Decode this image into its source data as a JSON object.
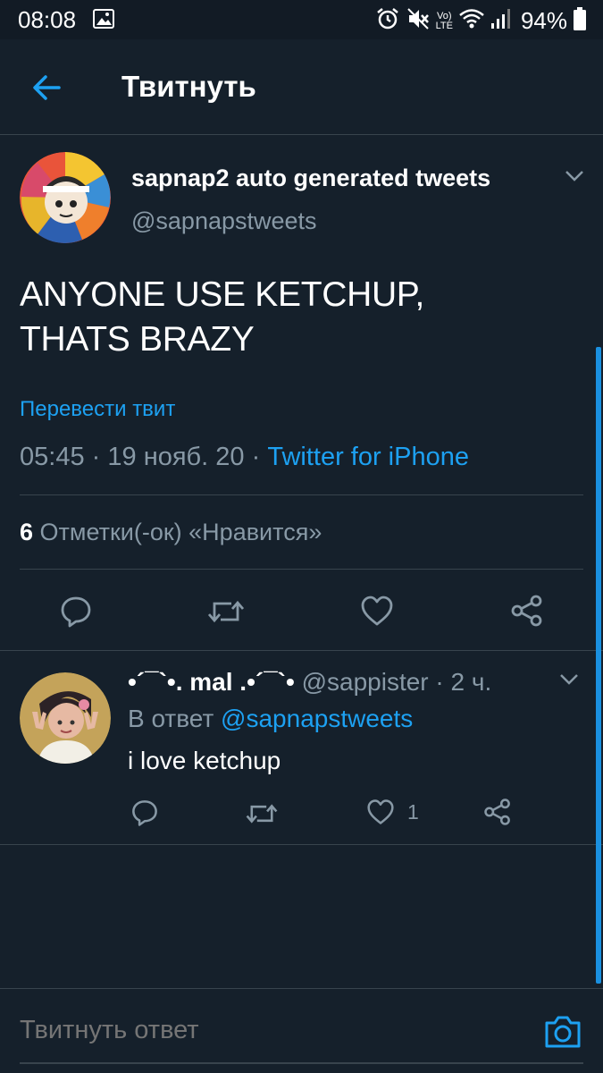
{
  "status_bar": {
    "time": "08:08",
    "battery": "94%",
    "lte_label_top": "Vo)",
    "lte_label_bottom": "LTE"
  },
  "header": {
    "title": "Твитнуть"
  },
  "main_tweet": {
    "author_name": "sapnap2 auto generated tweets",
    "author_handle": "@sapnapstweets",
    "text_line1": "ANYONE USE KETCHUP,",
    "text_line2": "THATS BRAZY",
    "translate_label": "Перевести твит",
    "time": "05:45",
    "date": "19 нояб. 20",
    "separator": "·",
    "source": "Twitter for iPhone",
    "likes_count": "6",
    "likes_label": "Отметки(-ок) «Нравится»"
  },
  "reply": {
    "name": "•´¯`•. mal .•´¯`•",
    "handle": "@sappister",
    "time_ago": "2 ч.",
    "separator": "·",
    "reply_to_prefix": "В ответ",
    "reply_to_mention": "@sapnapstweets",
    "text": "i love ketchup",
    "likes": "1"
  },
  "compose": {
    "placeholder": "Твитнуть ответ"
  },
  "colors": {
    "background": "#15202b",
    "accent": "#1da1f2",
    "muted": "#8899a6",
    "divider": "#38444d"
  },
  "icons": [
    "back-arrow-icon",
    "chevron-down-icon",
    "reply-icon",
    "retweet-icon",
    "like-icon",
    "share-icon",
    "camera-icon",
    "gallery-icon",
    "alarm-icon",
    "mute-icon",
    "wifi-icon",
    "signal-icon",
    "battery-icon"
  ]
}
